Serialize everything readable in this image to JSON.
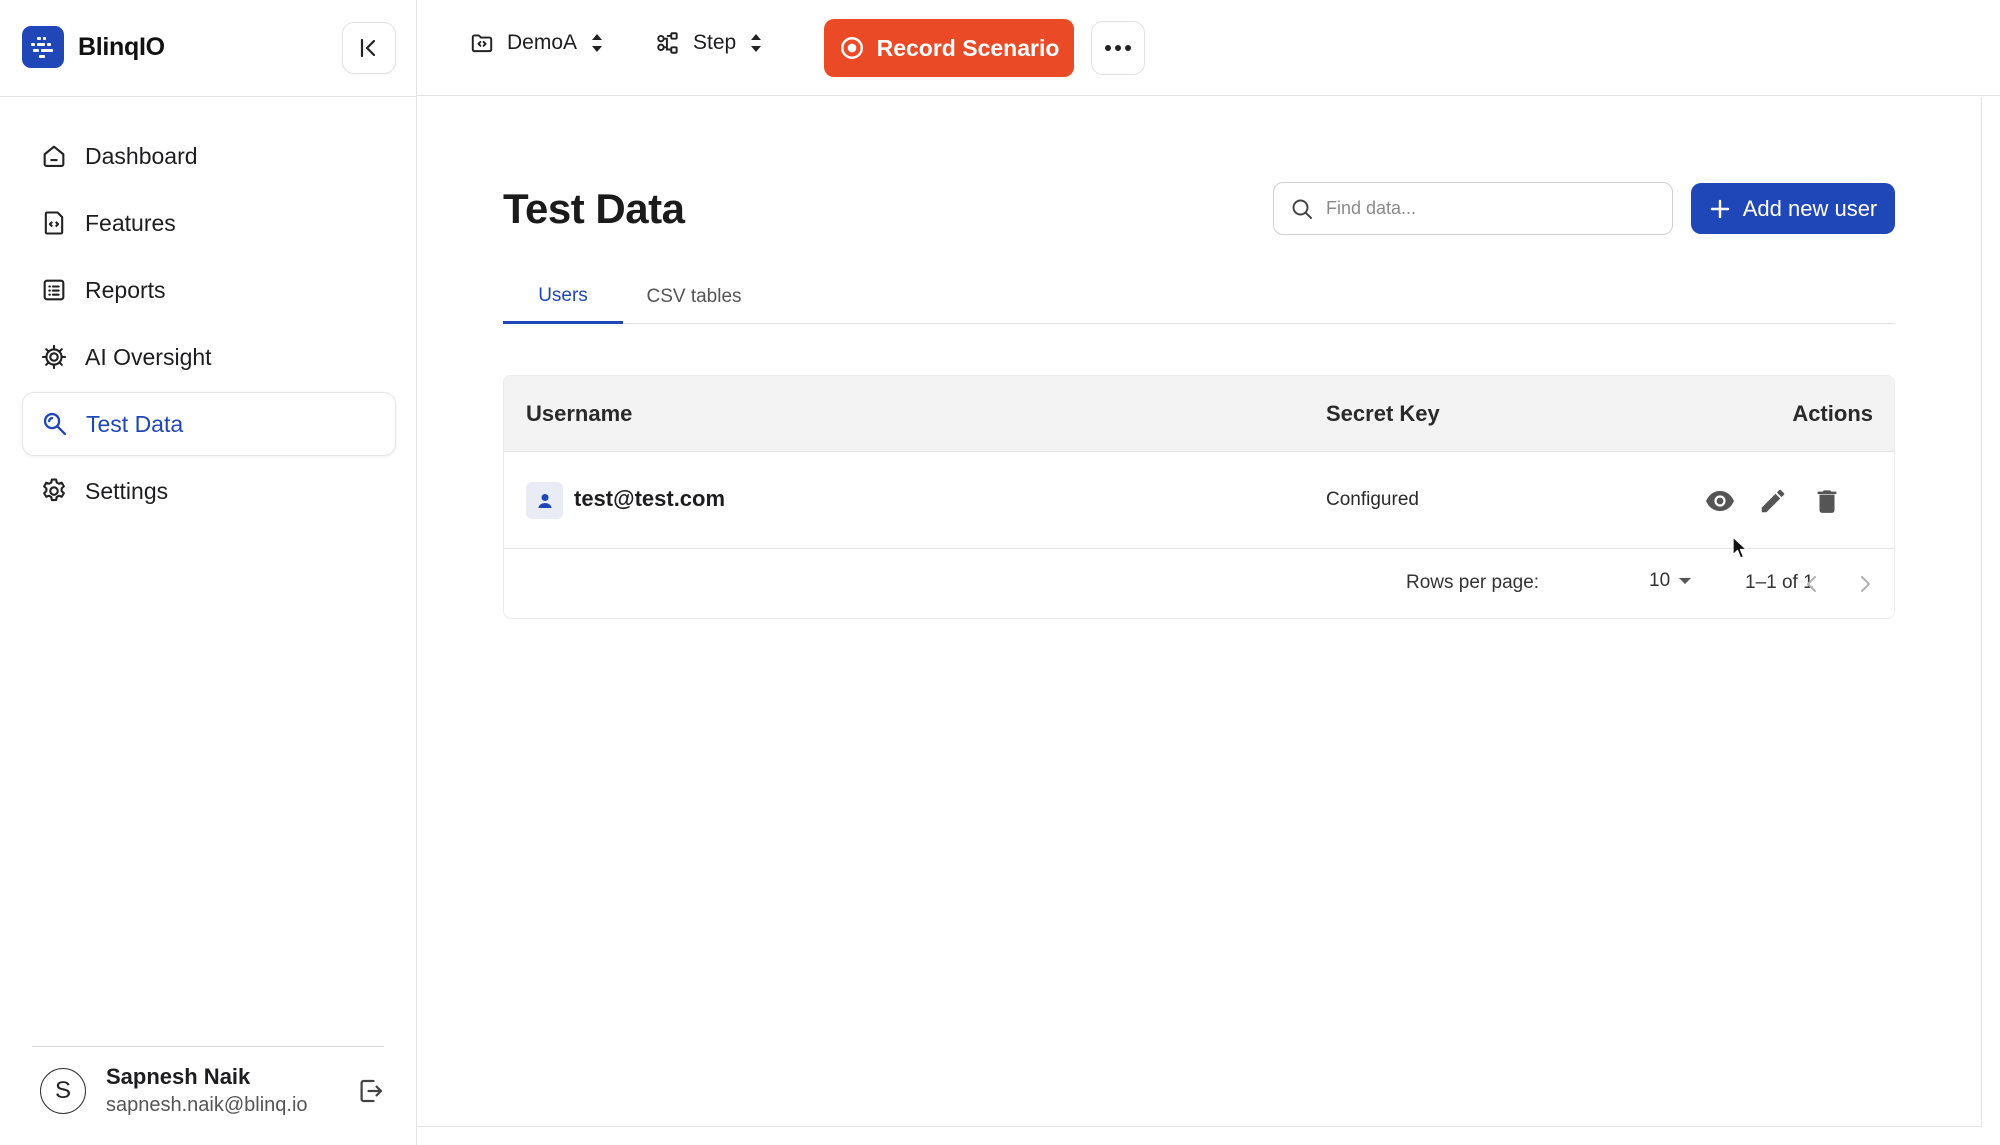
{
  "app": {
    "name": "BlinqIO",
    "brand_color": "#1f47b8",
    "accent_color": "#ea4a25"
  },
  "sidebar": {
    "items": [
      {
        "label": "Dashboard",
        "icon": "home-icon",
        "active": false
      },
      {
        "label": "Features",
        "icon": "feature-file-icon",
        "active": false
      },
      {
        "label": "Reports",
        "icon": "report-list-icon",
        "active": false
      },
      {
        "label": "AI Oversight",
        "icon": "ai-gear-icon",
        "active": false
      },
      {
        "label": "Test Data",
        "icon": "search-data-icon",
        "active": true
      },
      {
        "label": "Settings",
        "icon": "settings-icon",
        "active": false
      }
    ],
    "user": {
      "initial": "S",
      "name": "Sapnesh Naik",
      "email": "sapnesh.naik@blinq.io"
    }
  },
  "topbar": {
    "project": "DemoA",
    "mode": "Step",
    "record_label": "Record Scenario"
  },
  "page": {
    "title": "Test Data",
    "search_placeholder": "Find data...",
    "add_label": "Add new user",
    "tabs": [
      {
        "label": "Users",
        "active": true
      },
      {
        "label": "CSV tables",
        "active": false
      }
    ]
  },
  "table": {
    "columns": [
      "Username",
      "Secret Key",
      "Actions"
    ],
    "rows": [
      {
        "username": "test@test.com",
        "secret_key": "Configured"
      }
    ],
    "footer": {
      "rows_per_page_label": "Rows per page:",
      "rows_per_page": "10",
      "range": "1–1 of 1"
    }
  }
}
